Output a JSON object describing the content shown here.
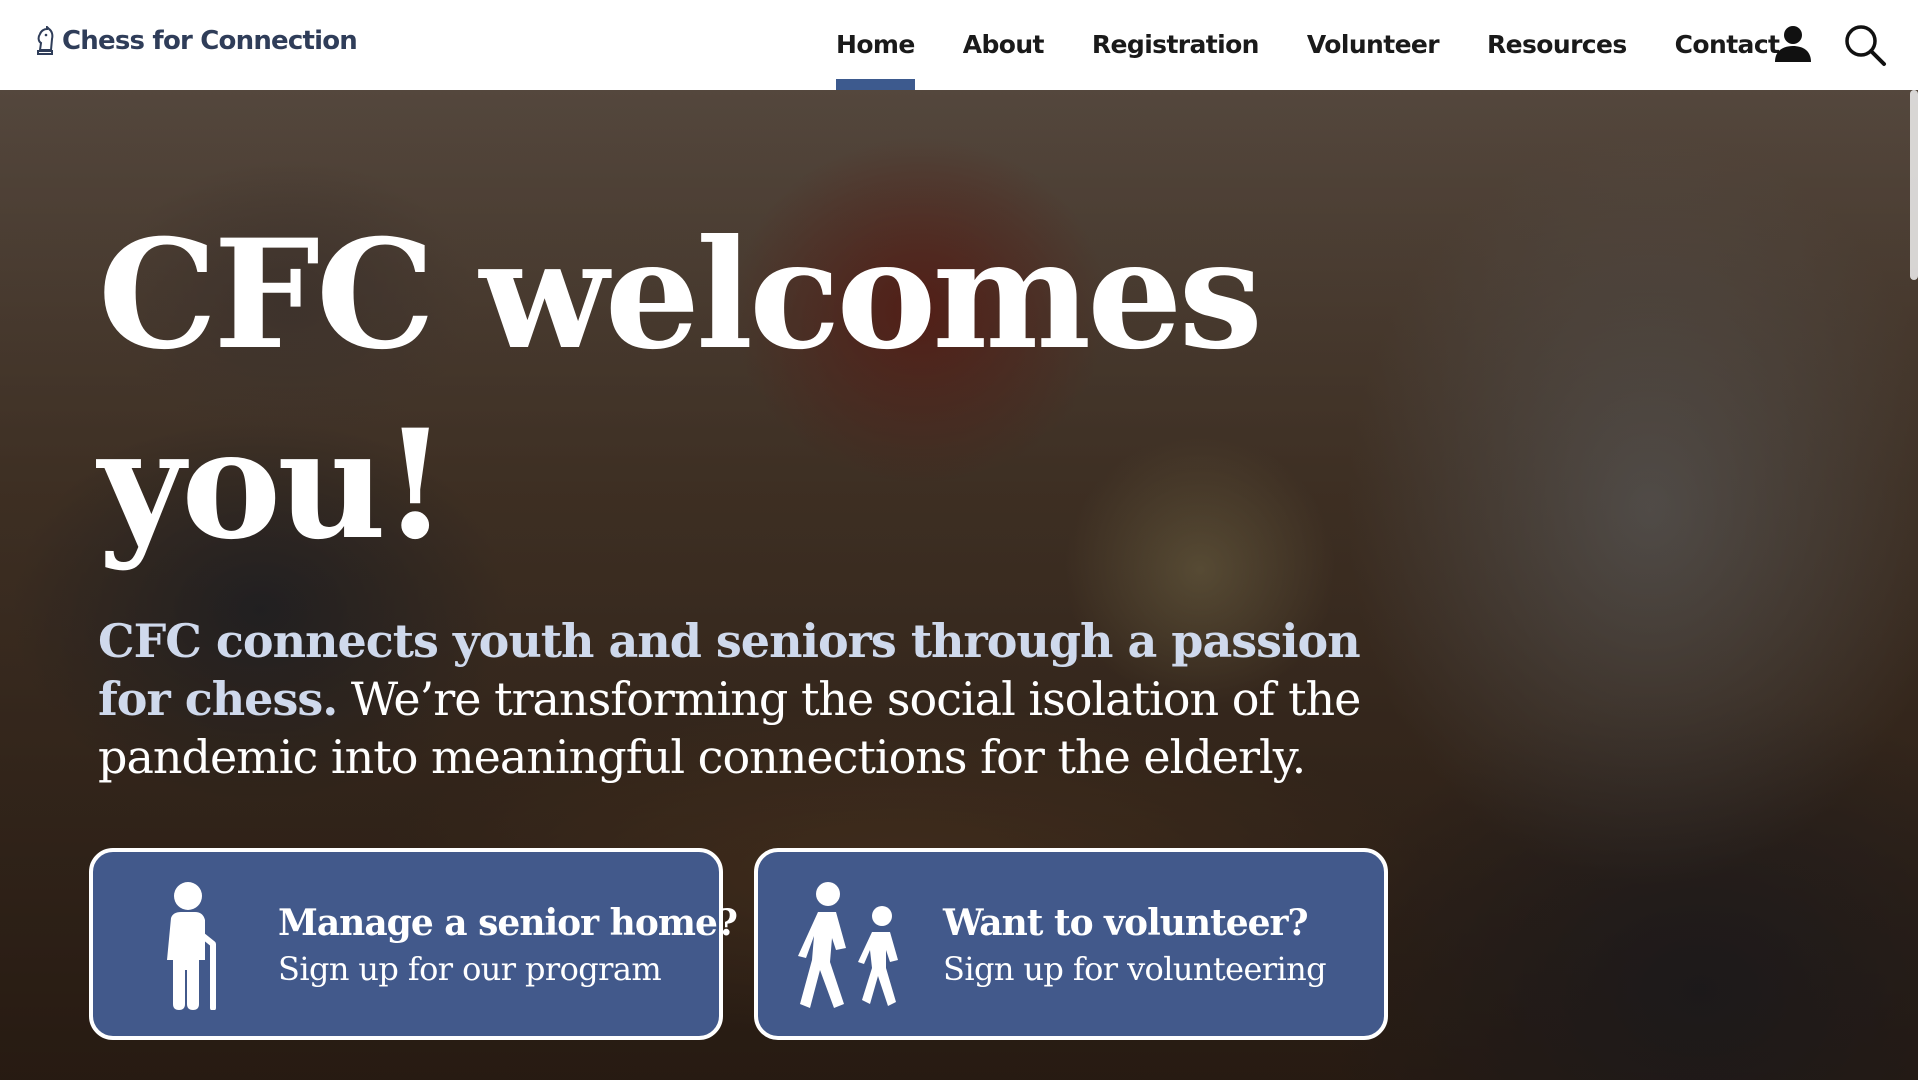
{
  "header": {
    "brand": "Chess for Connection",
    "brand_icon": "chess-knight-icon",
    "nav": [
      {
        "label": "Home",
        "active": true
      },
      {
        "label": "About",
        "active": false
      },
      {
        "label": "Registration",
        "active": false
      },
      {
        "label": "Volunteer",
        "active": false
      },
      {
        "label": "Resources",
        "active": false
      },
      {
        "label": "Contact",
        "active": false
      }
    ],
    "icons": [
      "user-icon",
      "search-icon"
    ]
  },
  "hero": {
    "title": "CFC welcomes you!",
    "description_lead": "CFC connects youth and seniors through a passion for chess.",
    "description_rest": " We’re transforming the social isolation of the pandemic into meaningful connections for the elderly."
  },
  "cards": [
    {
      "title": "Manage a senior home?",
      "subtitle": "Sign up for our program",
      "icon": "elderly-person-icon"
    },
    {
      "title": "Want to volunteer?",
      "subtitle": "Sign up for volunteering",
      "icon": "walking-people-icon"
    }
  ],
  "colors": {
    "brand": "#2f3d59",
    "accent": "#3d5a8e",
    "card_bg": "#42598b",
    "lead_text": "#cfd9ec"
  }
}
